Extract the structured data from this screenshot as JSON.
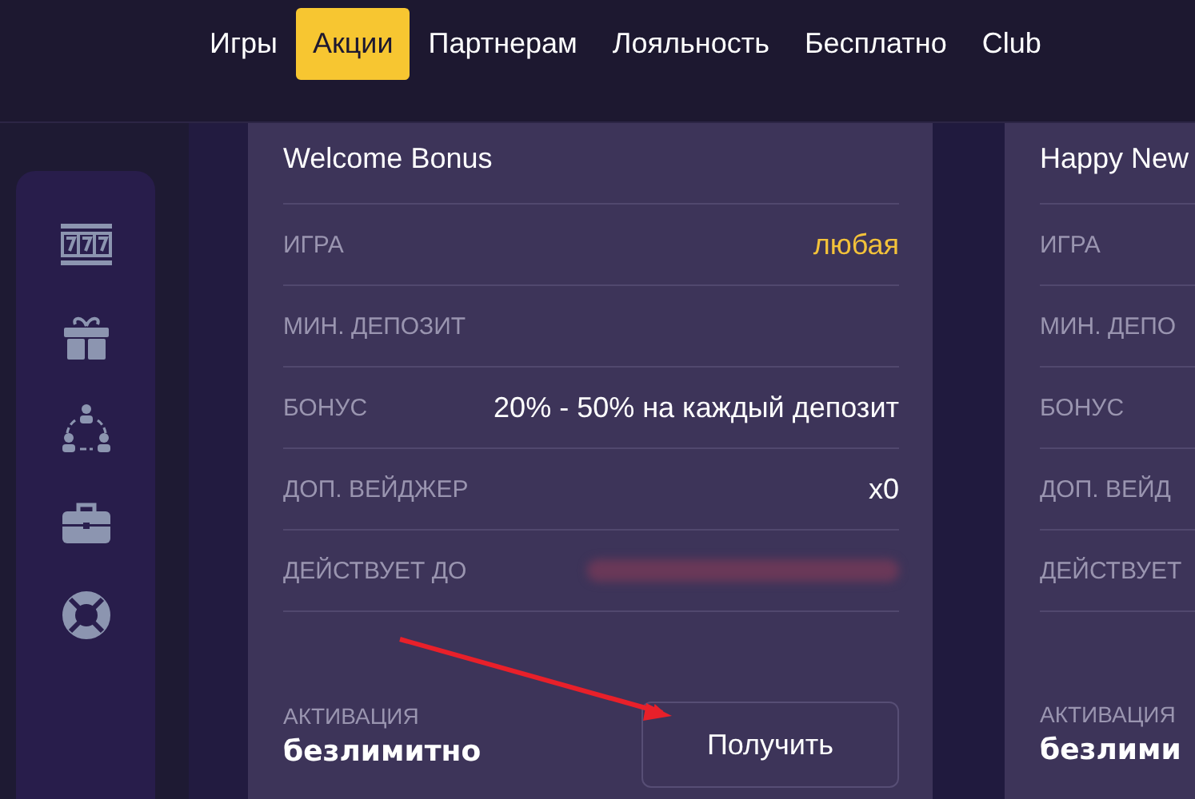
{
  "nav": [
    {
      "label": "Игры",
      "selected": false
    },
    {
      "label": "Акции",
      "selected": true
    },
    {
      "label": "Партнерам",
      "selected": false
    },
    {
      "label": "Лояльность",
      "selected": false
    },
    {
      "label": "Бесплатно",
      "selected": false
    },
    {
      "label": "Club",
      "selected": false
    }
  ],
  "sidebar": {
    "items": [
      {
        "kind": "slots"
      },
      {
        "kind": "gift"
      },
      {
        "kind": "people"
      },
      {
        "kind": "briefcase"
      },
      {
        "kind": "lifebuoy"
      }
    ]
  },
  "cards": [
    {
      "title": "Welcome Bonus",
      "rows": [
        {
          "label": "ИГРА",
          "value": "любая",
          "highlight": true
        },
        {
          "label": "МИН. ДЕПОЗИТ"
        },
        {
          "label": "БОНУС",
          "value": "20% - 50% на каждый депозит",
          "highlight": false
        },
        {
          "label": "ДОП. ВЕЙДЖЕР",
          "value": "x0",
          "highlight": false
        },
        {
          "label": "ДЕЙСТВУЕТ ДО",
          "redacted": true
        }
      ],
      "activation_label": "АКТИВАЦИЯ",
      "activation_value": "безлимитно",
      "button": "Получить"
    },
    {
      "title": "Happy New",
      "rows": [
        {
          "label": "ИГРА"
        },
        {
          "label": "МИН. ДЕПО"
        },
        {
          "label": "БОНУС"
        },
        {
          "label": "ДОП. ВЕЙД"
        },
        {
          "label": "ДЕЙСТВУЕТ"
        }
      ],
      "activation_label": "АКТИВАЦИЯ",
      "activation_value": "безлими"
    }
  ]
}
